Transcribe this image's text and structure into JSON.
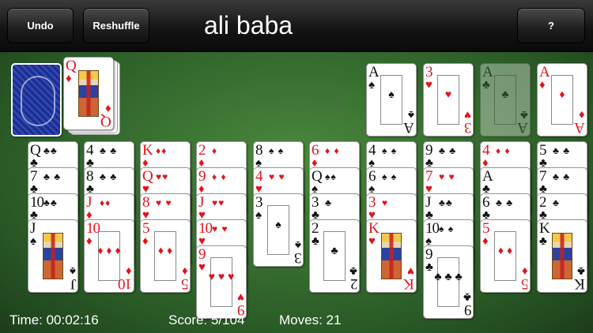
{
  "toolbar": {
    "undo_label": "Undo",
    "reshuffle_label": "Reshuffle",
    "help_label": "?"
  },
  "game": {
    "title": "ali baba"
  },
  "stock": {
    "remaining": "stacked"
  },
  "waste": {
    "top": {
      "rank": "Q",
      "suit": "♦",
      "color": "red"
    }
  },
  "foundations": [
    {
      "rank": "A",
      "suit": "♠",
      "color": "black",
      "pips": "♠"
    },
    {
      "rank": "3",
      "suit": "♥",
      "color": "red",
      "pips": "♥"
    },
    {
      "rank": "A",
      "suit": "♣",
      "color": "black",
      "pips": "♣"
    },
    {
      "rank": "A",
      "suit": "♦",
      "color": "red",
      "pips": "♦"
    }
  ],
  "tableau": [
    {
      "cards": [
        {
          "rank": "Q",
          "suit": "♣",
          "color": "black",
          "extra": "♣♣"
        },
        {
          "rank": "7",
          "suit": "♣",
          "color": "black",
          "extra": "♣ ♣"
        },
        {
          "rank": "10",
          "suit": "♣",
          "color": "black",
          "extra": "♣♣"
        },
        {
          "rank": "J",
          "suit": "♠",
          "color": "black",
          "face": true
        }
      ]
    },
    {
      "cards": [
        {
          "rank": "4",
          "suit": "♣",
          "color": "black",
          "extra": "♣ ♣"
        },
        {
          "rank": "8",
          "suit": "♣",
          "color": "black",
          "extra": "♣ ♣"
        },
        {
          "rank": "J",
          "suit": "♦",
          "color": "red",
          "extra": "♦♦"
        },
        {
          "rank": "10",
          "suit": "♦",
          "color": "red",
          "pips": "♦ ♦ ♦"
        }
      ]
    },
    {
      "cards": [
        {
          "rank": "K",
          "suit": "♦",
          "color": "red",
          "extra": "♦♦"
        },
        {
          "rank": "Q",
          "suit": "♥",
          "color": "red",
          "extra": "♥♥"
        },
        {
          "rank": "8",
          "suit": "♥",
          "color": "red",
          "extra": "♥ ♥"
        },
        {
          "rank": "5",
          "suit": "♦",
          "color": "red",
          "pips": "♦ ♦"
        }
      ]
    },
    {
      "cards": [
        {
          "rank": "2",
          "suit": "♦",
          "color": "red",
          "extra": "♦"
        },
        {
          "rank": "9",
          "suit": "♦",
          "color": "red",
          "extra": "♦ ♦"
        },
        {
          "rank": "J",
          "suit": "♥",
          "color": "red",
          "extra": "♥♥"
        },
        {
          "rank": "10",
          "suit": "♥",
          "color": "red",
          "extra": "♥ ♥"
        },
        {
          "rank": "9",
          "suit": "♥",
          "color": "red",
          "pips": "♥ ♥ ♥"
        }
      ]
    },
    {
      "cards": [
        {
          "rank": "8",
          "suit": "♠",
          "color": "black",
          "extra": "♠ ♠"
        },
        {
          "rank": "4",
          "suit": "♥",
          "color": "red",
          "extra": "♥ ♥"
        },
        {
          "rank": "3",
          "suit": "♠",
          "color": "black",
          "pips": "♠"
        }
      ]
    },
    {
      "cards": [
        {
          "rank": "6",
          "suit": "♦",
          "color": "red",
          "extra": "♦ ♦"
        },
        {
          "rank": "Q",
          "suit": "♠",
          "color": "black",
          "extra": "♠♠"
        },
        {
          "rank": "3",
          "suit": "♣",
          "color": "black",
          "extra": "♣"
        },
        {
          "rank": "2",
          "suit": "♣",
          "color": "black",
          "pips": "♣"
        }
      ]
    },
    {
      "cards": [
        {
          "rank": "4",
          "suit": "♠",
          "color": "black",
          "extra": "♠ ♠"
        },
        {
          "rank": "6",
          "suit": "♠",
          "color": "black",
          "extra": "♠ ♠"
        },
        {
          "rank": "3",
          "suit": "♥",
          "color": "red",
          "extra": "♥"
        },
        {
          "rank": "K",
          "suit": "♥",
          "color": "red",
          "face": true
        }
      ]
    },
    {
      "cards": [
        {
          "rank": "9",
          "suit": "♣",
          "color": "black",
          "extra": "♣ ♣"
        },
        {
          "rank": "7",
          "suit": "♥",
          "color": "red",
          "extra": "♥ ♥"
        },
        {
          "rank": "J",
          "suit": "♣",
          "color": "black",
          "extra": "♣♣"
        },
        {
          "rank": "10",
          "suit": "♠",
          "color": "black",
          "extra": "♠ ♠"
        },
        {
          "rank": "9",
          "suit": "♣",
          "color": "black",
          "pips": "♣ ♣ ♣"
        }
      ]
    },
    {
      "cards": [
        {
          "rank": "4",
          "suit": "♦",
          "color": "red",
          "extra": "♦ ♦"
        },
        {
          "rank": "A",
          "suit": "♣",
          "color": "black",
          "extra": ""
        },
        {
          "rank": "6",
          "suit": "♣",
          "color": "black",
          "extra": "♣ ♣"
        },
        {
          "rank": "5",
          "suit": "♦",
          "color": "red",
          "pips": "♦ ♦"
        }
      ]
    },
    {
      "cards": [
        {
          "rank": "5",
          "suit": "♣",
          "color": "black",
          "extra": "♣ ♣"
        },
        {
          "rank": "7",
          "suit": "♣",
          "color": "black",
          "extra": "♣ ♣"
        },
        {
          "rank": "2",
          "suit": "♣",
          "color": "black",
          "extra": "♣"
        },
        {
          "rank": "K",
          "suit": "♣",
          "color": "black",
          "face": true
        }
      ]
    }
  ],
  "status": {
    "time_label": "Time: 00:02:16",
    "score_label": "Score: 5/104",
    "moves_label": "Moves: 21"
  }
}
